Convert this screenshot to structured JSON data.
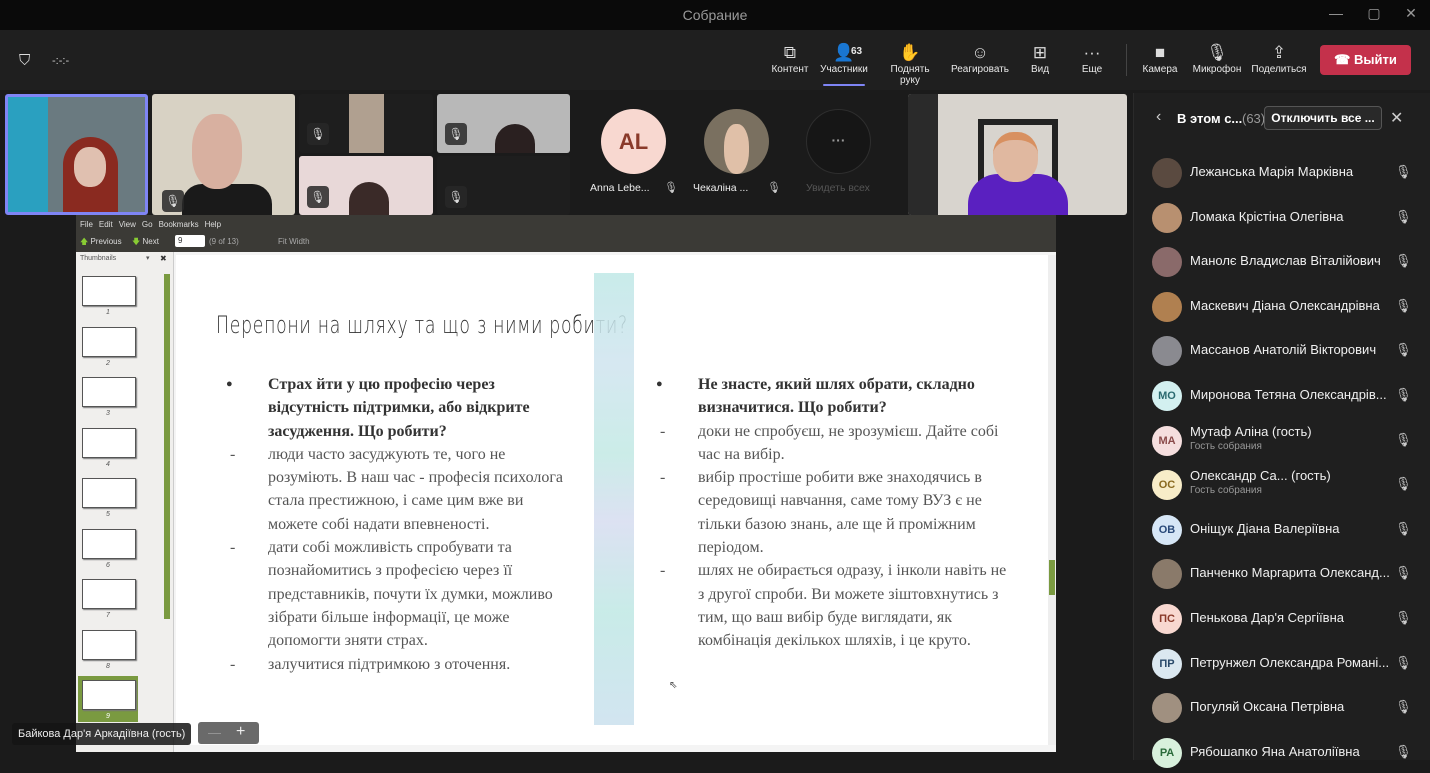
{
  "window": {
    "title": "Собрание",
    "minimize": "—",
    "maximize": "▢",
    "close": "✕"
  },
  "toolbar": {
    "timer": "-:-:-",
    "items": [
      {
        "label": "Контент",
        "icon": "⧉"
      },
      {
        "label": "Участники",
        "icon": "👤",
        "count": "63"
      },
      {
        "label": "Поднять руку",
        "icon": "✋"
      },
      {
        "label": "Реагировать",
        "icon": "☺"
      },
      {
        "label": "Вид",
        "icon": "⊞"
      },
      {
        "label": "Еще",
        "icon": "···"
      },
      {
        "label": "Камера",
        "icon": "■"
      },
      {
        "label": "Микрофон",
        "icon": "🎙"
      },
      {
        "label": "Поделиться",
        "icon": "⇪"
      }
    ],
    "leave": "Выйти"
  },
  "videos": {
    "tiles": [
      {
        "name": "Anna Lebe...",
        "initials": "AL"
      },
      {
        "name": "Чекаліна ..."
      }
    ],
    "see_all": "Увидеть всех",
    "more": "···"
  },
  "viewer": {
    "menu": [
      "File",
      "Edit",
      "View",
      "Go",
      "Bookmarks",
      "Help"
    ],
    "previous": "Previous",
    "next": "Next",
    "page_input": "9",
    "page_of": "(9 of 13)",
    "fit": "Fit Width",
    "thumbnails_label": "Thumbnails",
    "thumb_numbers": [
      "1",
      "2",
      "3",
      "4",
      "5",
      "6",
      "7",
      "8",
      "9"
    ],
    "current_page": 9
  },
  "slide": {
    "title": "Перепони на шляху та що з ними робити?",
    "left": {
      "heading": "Страх йти у цю професію через відсутність підтримки, або відкрите засудження. Що робити?",
      "points": [
        "люди часто засуджують те, чого не розуміють. В наш час - професія психолога стала престижною, і саме цим вже ви можете собі надати впевненості.",
        "дати собі можливість спробувати та познайомитись з професією через її представників, почути їх думки, можливо зібрати більше інформації, це може допомогти зняти страх.",
        "залучитися підтримкою з оточення."
      ]
    },
    "right": {
      "heading": "Не знасте, який шлях обрати, складно визначитися. Що робити?",
      "points": [
        "доки не спробуєш, не зрозумієш. Дайте собі час на вибір.",
        "вибір простіше робити вже знаходячись в середовищі навчання, саме тому ВУЗ є не тільки базою знань, але ще й проміжним періодом.",
        "шлях не обирається одразу, і інколи навіть не з другої спроби. Ви можете зіштовхнутись з тим, що ваш вибір буде виглядати, як комбінація декількох шляхів, і це круто."
      ]
    }
  },
  "presenter": {
    "name": "Байкова Дар'я Аркадіївна (гость)",
    "zoom_out": "—",
    "zoom_in": "+"
  },
  "panel": {
    "title": "В этом с...",
    "count": "(63)",
    "mute_all": "Отключить все ...",
    "participants": [
      {
        "name": "Лежанська Марія Марківна",
        "photo": "#5a4a40"
      },
      {
        "name": "Ломака Крістіна Олегівна",
        "photo": "#b89070"
      },
      {
        "name": "Манолє Владислав Віталійович",
        "photo": "#8a6a6a"
      },
      {
        "name": "Маскевич Діана Олександрівна",
        "photo": "#b08050"
      },
      {
        "name": "Массанов Анатолій Вікторович",
        "photo": "#8a8a90"
      },
      {
        "name": "Миронова Тетяна Олександрів...",
        "initials": "МО",
        "bg": "#d3f0f0",
        "fg": "#2a6a70"
      },
      {
        "name": "Мутаф Аліна (гость)",
        "sub": "Гость собрания",
        "initials": "МА",
        "bg": "#f5dede",
        "fg": "#8a4a4a"
      },
      {
        "name": "Олександр Са...  (гость)",
        "sub": "Гость собрания",
        "initials": "ОС",
        "bg": "#f7ecc8",
        "fg": "#8a6a20"
      },
      {
        "name": "Оніщук Діана Валеріївна",
        "initials": "ОВ",
        "bg": "#d6e6f6",
        "fg": "#2a4a7a"
      },
      {
        "name": "Панченко Маргарита Олександ...",
        "photo": "#8a7a6a"
      },
      {
        "name": "Пенькова Дар'я Сергіївна",
        "initials": "ПС",
        "bg": "#f8d8d0",
        "fg": "#8a3a2a"
      },
      {
        "name": "Петрунжел Олександра Романі...",
        "initials": "ПР",
        "bg": "#dbe8f0",
        "fg": "#2a4a6a"
      },
      {
        "name": "Погуляй Оксана Петрівна",
        "photo": "#a09080"
      },
      {
        "name": "Рябошапко Яна Анатоліївна",
        "initials": "РА",
        "bg": "#d8f0dc",
        "fg": "#2a6a3a"
      }
    ]
  },
  "colors": {
    "accent": "#7f85f5",
    "leave": "#c4314b",
    "viewer_green": "#7a9a40"
  }
}
